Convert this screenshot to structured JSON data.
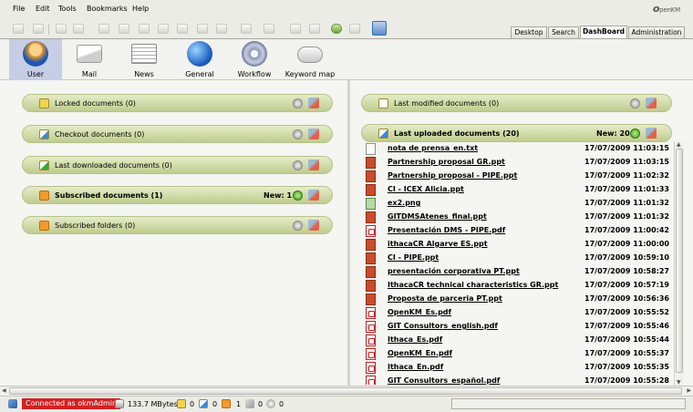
{
  "menu": [
    "File",
    "Edit",
    "Tools",
    "Bookmarks",
    "Help"
  ],
  "logo": {
    "main": "penKM",
    "prefix": "o"
  },
  "top_tabs": [
    {
      "label": "Desktop",
      "active": false
    },
    {
      "label": "Search",
      "active": false
    },
    {
      "label": "DashBoard",
      "active": true
    },
    {
      "label": "Administration",
      "active": false
    }
  ],
  "dashboard_nav": [
    {
      "label": "User",
      "icon": "user-icon",
      "selected": true
    },
    {
      "label": "Mail",
      "icon": "mail-icon",
      "selected": false
    },
    {
      "label": "News",
      "icon": "news-icon",
      "selected": false
    },
    {
      "label": "General",
      "icon": "globe-icon",
      "selected": false
    },
    {
      "label": "Workflow",
      "icon": "gears-icon",
      "selected": false
    },
    {
      "label": "Keyword map",
      "icon": "cloud-icon",
      "selected": false
    }
  ],
  "left_portlets": [
    {
      "title": "Locked documents",
      "count": "(0)",
      "icon": "lock-icon",
      "bold": false,
      "new": ""
    },
    {
      "title": "Checkout documents",
      "count": "(0)",
      "icon": "edit-icon",
      "bold": false,
      "new": ""
    },
    {
      "title": "Last downloaded documents",
      "count": "(0)",
      "icon": "download-icon",
      "bold": false,
      "new": ""
    },
    {
      "title": "Subscribed documents",
      "count": "(1)",
      "icon": "mail-icon",
      "bold": true,
      "new": "New: 1"
    },
    {
      "title": "Subscribed folders",
      "count": "(0)",
      "icon": "mail-icon",
      "bold": false,
      "new": ""
    }
  ],
  "right_portlets": [
    {
      "title": "Last modified documents",
      "count": "(0)",
      "icon": "document-icon",
      "bold": false,
      "new": ""
    },
    {
      "title": "Last uploaded documents",
      "count": "(20)",
      "icon": "upload-icon",
      "bold": true,
      "new": "New: 20"
    }
  ],
  "uploaded_documents": [
    {
      "name": "nota de prensa_en.txt",
      "date": "17/07/2009 11:03:15",
      "type": "txt"
    },
    {
      "name": "Partnership proposal GR.ppt",
      "date": "17/07/2009 11:03:15",
      "type": "ppt"
    },
    {
      "name": "Partnership proposal - PIPE.ppt",
      "date": "17/07/2009 11:02:32",
      "type": "ppt"
    },
    {
      "name": "CI - ICEX Alicia.ppt",
      "date": "17/07/2009 11:01:33",
      "type": "ppt"
    },
    {
      "name": "ex2.png",
      "date": "17/07/2009 11:01:32",
      "type": "img"
    },
    {
      "name": "GITDMSAtenes_final.ppt",
      "date": "17/07/2009 11:01:32",
      "type": "ppt"
    },
    {
      "name": "Presentación DMS - PIPE.pdf",
      "date": "17/07/2009 11:00:42",
      "type": "pdf"
    },
    {
      "name": "ithacaCR Algarve ES.ppt",
      "date": "17/07/2009 11:00:00",
      "type": "ppt"
    },
    {
      "name": "CI - PIPE.ppt",
      "date": "17/07/2009 10:59:10",
      "type": "ppt"
    },
    {
      "name": "presentación corporativa PT.ppt",
      "date": "17/07/2009 10:58:27",
      "type": "ppt"
    },
    {
      "name": "IthacaCR technical characteristics GR.ppt",
      "date": "17/07/2009 10:57:19",
      "type": "ppt"
    },
    {
      "name": "Proposta de parceria PT.ppt",
      "date": "17/07/2009 10:56:36",
      "type": "ppt"
    },
    {
      "name": "OpenKM_Es.pdf",
      "date": "17/07/2009 10:55:52",
      "type": "pdf"
    },
    {
      "name": "GIT Consultors_english.pdf",
      "date": "17/07/2009 10:55:46",
      "type": "pdf"
    },
    {
      "name": "Ithaca_Es.pdf",
      "date": "17/07/2009 10:55:44",
      "type": "pdf"
    },
    {
      "name": "OpenKM_En.pdf",
      "date": "17/07/2009 10:55:37",
      "type": "pdf"
    },
    {
      "name": "Ithaca_En.pdf",
      "date": "17/07/2009 10:55:35",
      "type": "pdf"
    },
    {
      "name": "GIT Consultors_español.pdf",
      "date": "17/07/2009 10:55:28",
      "type": "pdf"
    }
  ],
  "status": {
    "connected": "Connected as okmAdmin",
    "size": "133.7 MBytes",
    "locked": "0",
    "checkout": "0",
    "subscribed": "1",
    "news": "0",
    "other": "0"
  },
  "colors": {
    "accent": "#c0cc8e",
    "selected_nav": "#c6cee6",
    "status_red": "#d42020"
  }
}
